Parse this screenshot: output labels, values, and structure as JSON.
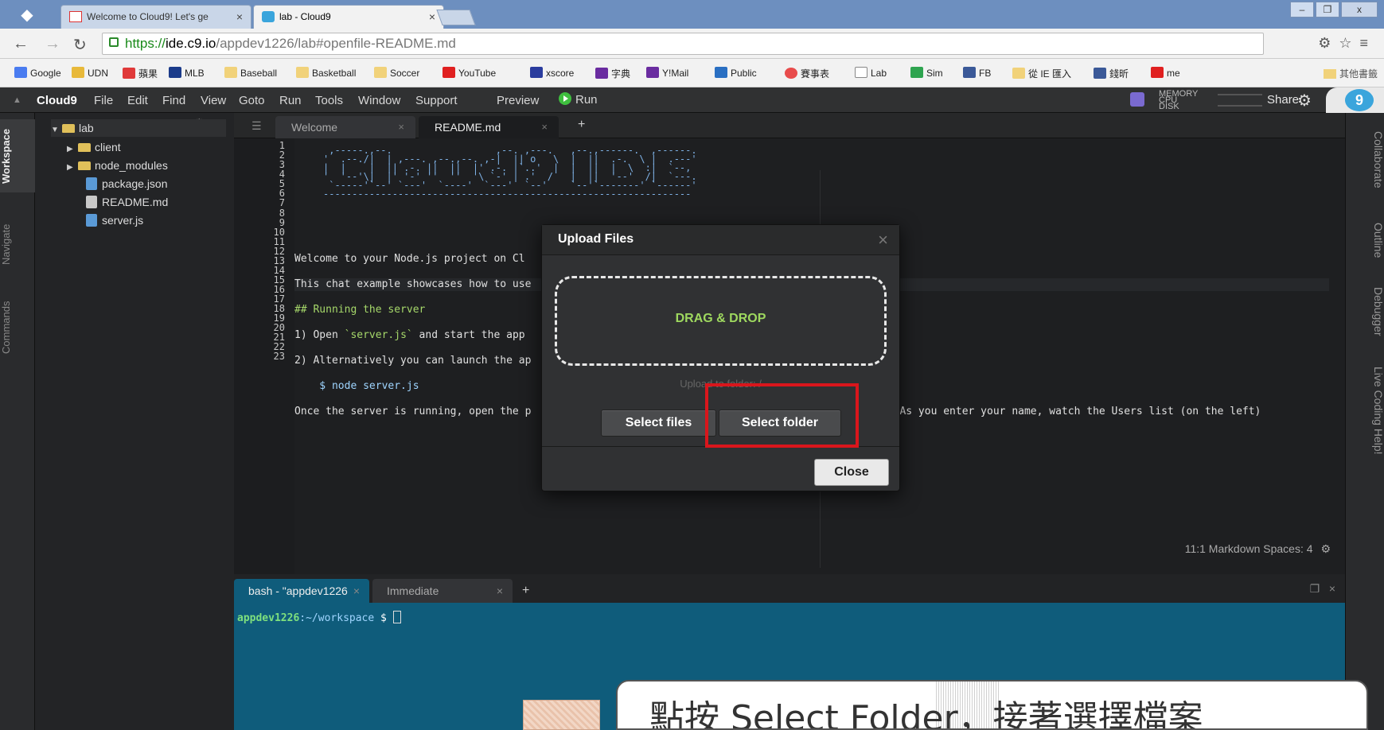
{
  "browser": {
    "tabs": [
      {
        "title": "Welcome to Cloud9! Let's ge",
        "favicon": "gmail-icon",
        "active": false
      },
      {
        "title": "lab - Cloud9",
        "favicon": "cloud9-icon",
        "active": true
      }
    ],
    "url_scheme": "https://",
    "url_host": "ide.c9.io",
    "url_path": "/appdev1226/lab#openfile-README.md",
    "bookmarks": [
      "Google",
      "UDN",
      "蘋果",
      "MLB",
      "Baseball",
      "Basketball",
      "Soccer",
      "YouTube",
      "xscore",
      "字典",
      "Y!Mail",
      "Public",
      "賽事表",
      "Lab",
      "Sim",
      "FB",
      "從 IE 匯入",
      "錢昕",
      "me"
    ],
    "other_bookmarks": "其他書籤",
    "win_close": "x"
  },
  "ide": {
    "brand": "Cloud9",
    "menu": [
      "File",
      "Edit",
      "Find",
      "View",
      "Goto",
      "Run",
      "Tools",
      "Window",
      "Support"
    ],
    "preview": "Preview",
    "run": "Run",
    "resources": [
      "MEMORY",
      "CPU",
      "DISK"
    ],
    "share": "Share",
    "logo": "9",
    "left_rail": [
      "Workspace",
      "Navigate",
      "Commands"
    ],
    "right_rail": [
      "Collaborate",
      "Outline",
      "Debugger",
      "Live Coding Help!"
    ],
    "tree": {
      "root": "lab",
      "items": [
        {
          "name": "client",
          "type": "folder"
        },
        {
          "name": "node_modules",
          "type": "folder"
        },
        {
          "name": "package.json",
          "type": "file"
        },
        {
          "name": "README.md",
          "type": "doc"
        },
        {
          "name": "server.js",
          "type": "file"
        }
      ]
    },
    "editor_tabs": [
      {
        "label": "Welcome",
        "active": false
      },
      {
        "label": "README.md",
        "active": true
      }
    ],
    "ascii_banner": " ,-----.,--.                  ,--. ,---.   ,--.,------.  ,------.\n'  .--./|  | ,---. ,--.,--. ,-|  || o   \\  |  ||  .-.  \\ |  .---'\n|  |    |  || .-. ||  ||  |' .-. |`..'  |  |  ||  |  \\  :|  `--,\n'  '--'\\|  |' '-' ''  ''  '\\ `-' | .'  /   |  ||  '--'  /|  `---.\n `-----'`--' `---'  `----'  `---'  `--'    `--'`-------' `------'\n----------------------------------------------------------------",
    "code_lines": {
      "l10": "Welcome to your Node.js project on Cl",
      "l12": "This chat example showcases how to use",
      "l14": "## Running the server",
      "l16a": "1) Open ",
      "l16b": "`server.js`",
      "l16c": " and start the app",
      "l18": "2) Alternatively you can launch the ap",
      "l20": "    $ node server.js",
      "l22a": "Once the server is running, open the p",
      "l22b": "c9.io/'. As you enter your name, watch the Users list (on the left)"
    },
    "status": "11:1   Markdown   Spaces: 4",
    "terminal_tabs": [
      {
        "label": "bash - \"appdev1226",
        "active": true
      },
      {
        "label": "Immediate",
        "active": false
      }
    ],
    "prompt_user": "appdev1226",
    "prompt_path": ":~/workspace",
    "prompt_sign": " $ "
  },
  "dialog": {
    "title": "Upload Files",
    "drop_label": "DRAG & DROP",
    "upload_to": "Upload to folder: /",
    "select_files": "Select files",
    "select_folder": "Select folder",
    "close": "Close",
    "highlight_color": "#d9161c"
  },
  "caption": {
    "text": "點按 Select Folder，接著選擇檔案"
  }
}
